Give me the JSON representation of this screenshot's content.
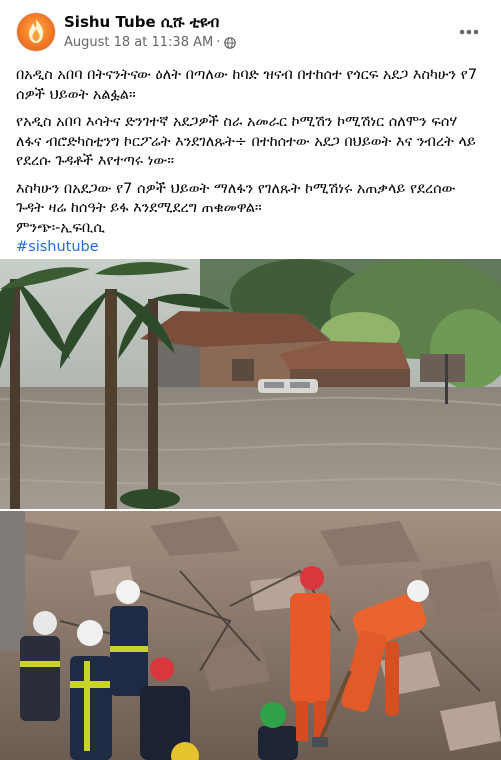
{
  "post": {
    "author": "Sishu Tube ሲሹ ቲዩብ",
    "date": "August 18 at 11:38 AM",
    "separator": "·",
    "privacy_icon": "globe-icon",
    "more_icon": "more-options-icon",
    "paragraphs": [
      "በአዲስ አበባ በትናንትናው ዕለት በጣለው ከባድ ዝናብ በተከሰተ የጎርፍ አደጋ እስካሁን የ7 ሰዎች ህይወት አልፏል።",
      "የአዲስ አበባ እሳትና ድንገተኛ አደጋዎች ስራ አመራር ኮሚሽን ኮሚሽነር ሰለሞን ፍሰሃ ለፋና ብሮድካስቲንግ ኮርፖሬት እንደገለጹት÷ በተከሰተው አደጋ በህይወት እና ንብረት ላይ የደረሱ ጉዳቶች እየተጣሩ ነው።",
      "እስካሁን በአደጋው የ7 ሰዎች ህይወት ማለፋን የገለጹት ኮሚሽነሩ አጠቃላይ የደረሰው ጉዳት ዛሬ ከሰዓት ይፋ እንደሚደረግ ጠቁመዋል።"
    ],
    "source": "ምንጭ፡-ኢፍቢሲ",
    "hashtag": "#sishutube"
  },
  "images": [
    {
      "icon": "flood-photo"
    },
    {
      "icon": "rescue-photo"
    }
  ],
  "colors": {
    "hashtag": "#216fdb",
    "meta_text": "#65676b",
    "brand_orange": "#f4822a"
  }
}
